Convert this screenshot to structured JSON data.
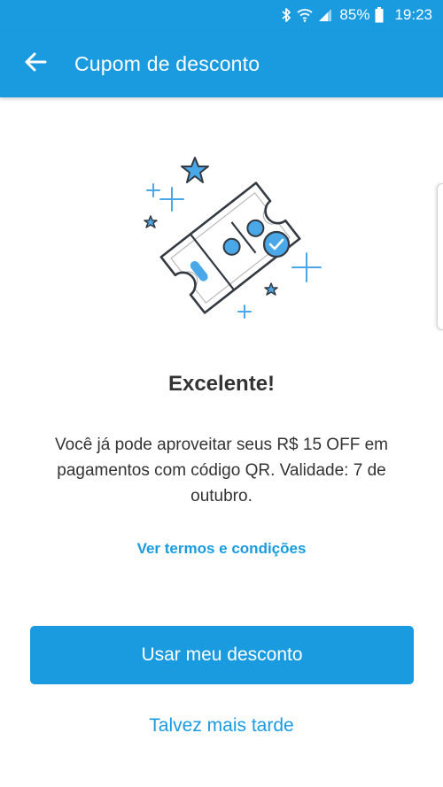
{
  "status_bar": {
    "icons": [
      "bluetooth-icon",
      "wifi-icon",
      "signal-icon",
      "battery-icon"
    ],
    "battery": "85%",
    "time": "19:23"
  },
  "app_bar": {
    "back_icon": "arrow-left-icon",
    "title": "Cupom de desconto"
  },
  "illustration": {
    "icon": "discount-ticket-icon",
    "symbol": "%"
  },
  "content": {
    "headline": "Excelente!",
    "description": "Você já pode aproveitar seus R$ 15 OFF em pagamentos com código QR. Validade: 7 de outubro.",
    "terms_link": "Ver termos e condições"
  },
  "actions": {
    "primary_label": "Usar meu desconto",
    "secondary_label": "Talvez mais tarde"
  },
  "colors": {
    "brand_blue": "#1a9be0",
    "text_dark": "#333333",
    "illustration_stroke": "#333a42"
  }
}
